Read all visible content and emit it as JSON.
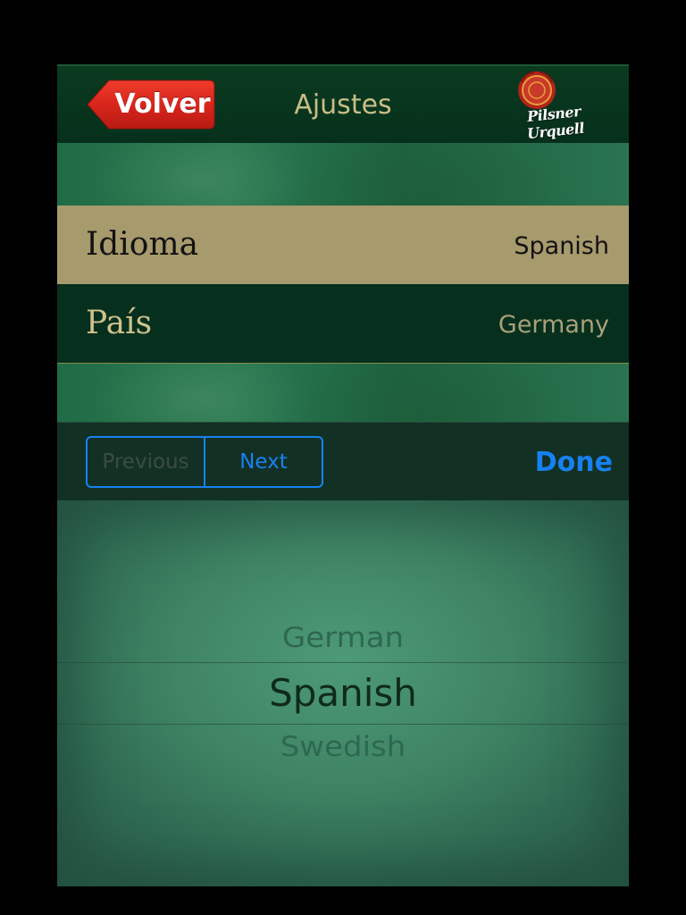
{
  "nav": {
    "back_label": "Volver",
    "title": "Ajustes",
    "brand_text": "Pilsner Urquell",
    "back_color": "#d9261c"
  },
  "settings": {
    "rows": [
      {
        "label": "Idioma",
        "value": "Spanish",
        "selected": true
      },
      {
        "label": "País",
        "value": "Germany",
        "selected": false
      }
    ]
  },
  "toolbar": {
    "previous_label": "Previous",
    "next_label": "Next",
    "done_label": "Done",
    "accent_color": "#1681f0",
    "previous_enabled": false
  },
  "picker": {
    "above": "German",
    "selected": "Spanish",
    "below": "Swedish"
  },
  "icons": {
    "back": "back-arrow-icon",
    "brand_seal": "wax-seal-icon"
  }
}
